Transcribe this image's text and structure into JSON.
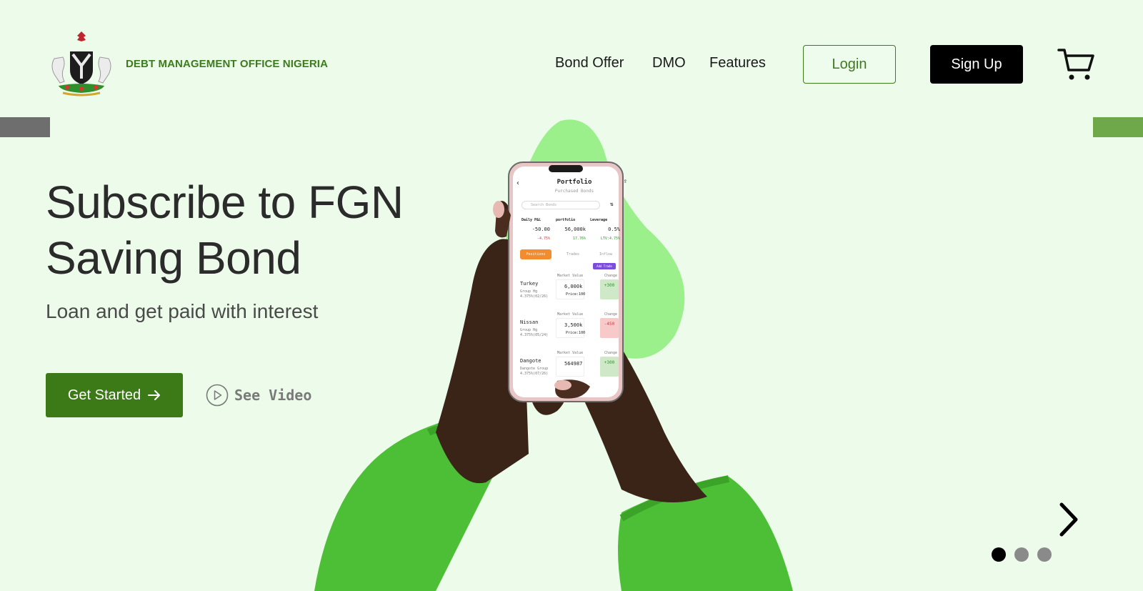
{
  "header": {
    "brand": "DEBT MANAGEMENT OFFICE NIGERIA",
    "nav": [
      "Bond Offer",
      "DMO",
      "Features"
    ],
    "login": "Login",
    "signup": "Sign Up",
    "cart_icon": "cart-icon",
    "logo_icon": "nigeria-coat-of-arms"
  },
  "hero": {
    "title": "Subscribe to FGN Saving Bond",
    "subtitle": "Loan and get paid with interest",
    "cta": "Get Started",
    "cta_icon": "arrow-right-icon",
    "video": "See Video",
    "video_icon": "play-circle-icon"
  },
  "phone": {
    "title": "Portfolio",
    "subtitle": "Purchased Bonds",
    "search_placeholder": "Search Bonds",
    "stats": [
      {
        "label": "Daily P&L",
        "value": "-50.00",
        "delta": "-4.75%"
      },
      {
        "label": "portfolio",
        "value": "56,000k",
        "delta": "17.76%"
      },
      {
        "label": "Leverage",
        "value": "0.5%",
        "delta": "LTV:4.75%"
      }
    ],
    "tabs": [
      "Positions",
      "Trades",
      "Inflow"
    ],
    "add_trade": "Add Trade",
    "rows": [
      {
        "name": "Turkey",
        "group": "Group Hg",
        "rate": "4.375%(02/26)",
        "value": "6,000k",
        "price": "Price:100",
        "change": "+300"
      },
      {
        "name": "Nissan",
        "group": "Group Hg",
        "rate": "4.375%(05/24)",
        "value": "3,500k",
        "price": "Price:100",
        "change": "-450"
      },
      {
        "name": "Dangote",
        "group": "Dangote Group",
        "rate": "4.375%(07/26)",
        "value": "564987",
        "price": "",
        "change": "+300"
      }
    ],
    "column_market": "Market Value",
    "column_change": "Change",
    "currency": "USD"
  },
  "carousel": {
    "next_icon": "chevron-right-icon",
    "slides": 3,
    "active": 1
  },
  "colors": {
    "background": "#ecfbea",
    "brand_green": "#3e7a1e",
    "cta_green": "#3b7a17",
    "sleeve_green": "#4cbf37",
    "blob_green": "#9bf08c"
  }
}
